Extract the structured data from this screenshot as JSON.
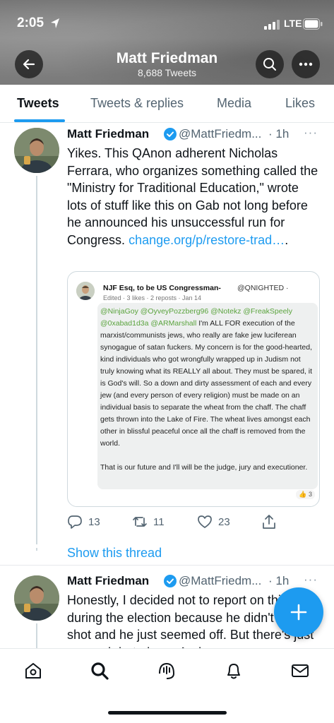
{
  "status_bar": {
    "time": "2:05",
    "network": "LTE"
  },
  "profile_header": {
    "name": "Matt Friedman",
    "tweet_count": "8,688 Tweets"
  },
  "tabs": [
    {
      "label": "Tweets",
      "active": true
    },
    {
      "label": "Tweets & replies",
      "active": false
    },
    {
      "label": "Media",
      "active": false
    },
    {
      "label": "Likes",
      "active": false
    }
  ],
  "tweets": [
    {
      "author": "Matt Friedman",
      "handle": "@MattFriedm...",
      "time": "· 1h",
      "text": "Yikes. This QAnon adherent Nicholas Ferrara, who organizes something called the \"Ministry for Traditional Education,\" wrote lots of stuff like this on Gab not long before he announced his unsuccessful run for Congress.",
      "link": "change.org/p/restore-trad…",
      "link_suffix": ".",
      "quoted_image": {
        "name": "NJF Esq, to be US Congressman-",
        "handle": "@QNIGHTED ·",
        "meta": "Edited · 3 likes · 2 reposts · Jan 14",
        "mentions": "@NinjaGoy @OyveyPozzberg96 @Notekz @FreakSpeely @0xabad1d3a @ARMarshall",
        "body_1": " I'm ALL FOR execution of the marxist/communists jews, who really are fake jew luciferean synogague of satan fuckers. My concern is for the good-hearted, kind individuals who got wrongfully wrapped up in Judism not truly knowing what its REALLY all about. They must be spared, it is God's will. So a down and dirty assessment of each and every jew (and every person of every religion) must be made on an individual basis to separate the wheat from the chaff. The chaff gets thrown into the Lake of Fire. The wheat lives amongst each other in blissful peaceful once all the chaff is removed from the world.",
        "body_2": "That is our future and I'll will be the judge, jury and executioner.",
        "like_badge": "👍 3"
      },
      "replies": "13",
      "retweets": "11",
      "likes": "23",
      "show_thread": "Show this thread"
    },
    {
      "author": "Matt Friedman",
      "handle": "@MattFriedm...",
      "time": "· 1h",
      "text": "Honestly, I decided not to report on this guy during the election because he didn't have a shot and he just seemed off. But there's just so much hate here. And now"
    }
  ],
  "colors": {
    "accent": "#1d9bf0",
    "text": "#0f1419",
    "secondary": "#536471"
  },
  "icons": {
    "back": "arrow-left-icon",
    "search": "search-icon",
    "more": "more-icon",
    "verified": "verified-badge-icon",
    "reply": "reply-icon",
    "retweet": "retweet-icon",
    "like": "heart-icon",
    "share": "share-icon",
    "compose": "plus-icon",
    "home": "home-icon",
    "explore": "search-icon",
    "spaces": "spaces-icon",
    "notifications": "bell-icon",
    "messages": "mail-icon"
  }
}
